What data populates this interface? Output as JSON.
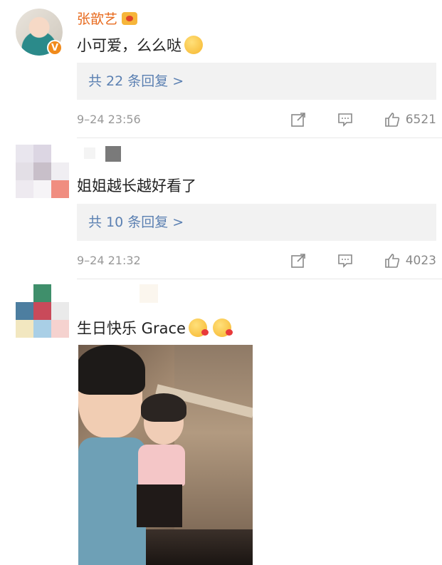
{
  "comments": [
    {
      "username": "张歆艺",
      "text": "小可爱，么么哒",
      "emoji": "smile-emoji",
      "replies": "共 22 条回复 >",
      "date": "9–24 23:56",
      "likes": "6521",
      "verified_badge": "V"
    },
    {
      "text": "姐姐越长越好看了",
      "replies": "共 10 条回复 >",
      "date": "9–24 21:32",
      "likes": "4023"
    },
    {
      "text": "生日快乐 Grace",
      "emoji": "kiss-emoji"
    }
  ],
  "icons": {
    "share": "share-icon",
    "comment": "comment-icon",
    "like": "thumbs-up-icon"
  },
  "colors": {
    "vip_name": "#e86b1f",
    "reply_link": "#5b80b2",
    "reply_bg": "#f2f2f2",
    "meta": "#999999"
  }
}
